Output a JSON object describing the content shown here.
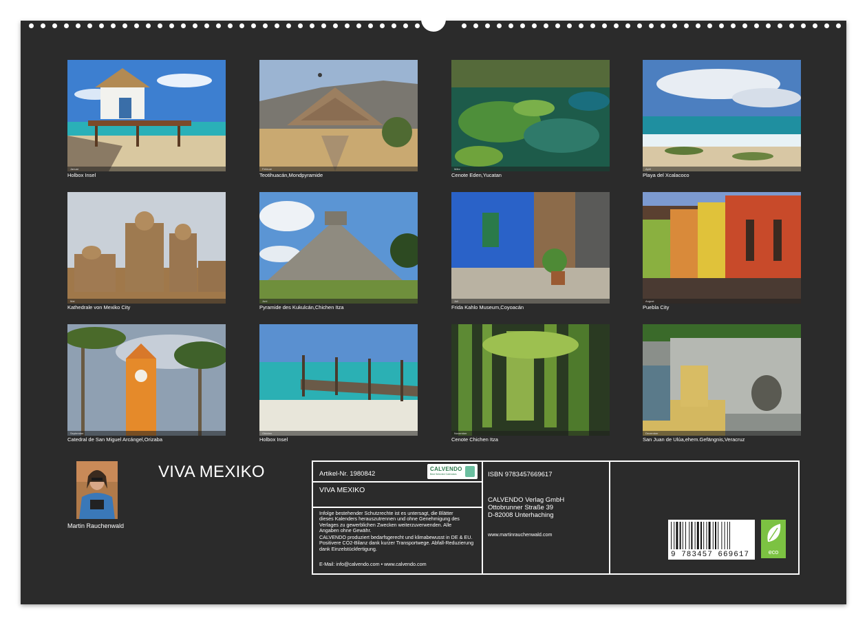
{
  "calendar": {
    "title": "VIVA MEXIKO",
    "author": "Martin Rauchenwald"
  },
  "photos": [
    {
      "month": "Januar",
      "caption": "Holbox Insel"
    },
    {
      "month": "Februar",
      "caption": "Teotihuacán,Mondpyramide"
    },
    {
      "month": "März",
      "caption": "Cenote Eden,Yucatan"
    },
    {
      "month": "April",
      "caption": "Playa del Xcalacoco"
    },
    {
      "month": "Mai",
      "caption": "Kathedrale von Mexiko City"
    },
    {
      "month": "Juni",
      "caption": "Pyramide des Kukulcán,Chichen Itza"
    },
    {
      "month": "Juli",
      "caption": "Frida Kahlo Museum,Coyoacán"
    },
    {
      "month": "August",
      "caption": "Puebla City"
    },
    {
      "month": "September",
      "caption": "Catedral de San Miguel Arcángel,Orizaba"
    },
    {
      "month": "Oktober",
      "caption": "Holbox Insel"
    },
    {
      "month": "November",
      "caption": "Cenote Chichen Itza"
    },
    {
      "month": "Dezember",
      "caption": "San Juan de Ulúa,ehem.Gefängnis,Veracruz"
    }
  ],
  "info": {
    "article": "Artikel-Nr. 1980842",
    "title": "VIVA MEXIKO",
    "logo": "CALVENDO",
    "logo_sub": "Best Selected Calendars",
    "legal": "Infolge bestehender Schutzrechte ist es untersagt, die Blätter dieses Kalenders herauszutrennen und ohne Genehmigung des Verlages zu gewerblichen Zwecken weiterzuverwenden. Alle Angaben ohne Gewähr.",
    "eco_text": "CALVENDO produziert bedarfsgerecht und klimabewusst in DE & EU. Positivere CO2-Bilanz dank kurzer Transportwege. Abfall-Reduzierung dank Einzelstückfertigung.",
    "contact": "E-Mail: info@calvendo.com • www.calvendo.com",
    "isbn": "ISBN 9783457669617",
    "publisher_name": "CALVENDO Verlag GmbH",
    "publisher_street": "Ottobrunner Straße 39",
    "publisher_city": "D-82008 Unterhaching",
    "website": "www.martinrauchenwald.com",
    "barcode_digits": "9 783457 669617",
    "eco_label": "eco"
  }
}
